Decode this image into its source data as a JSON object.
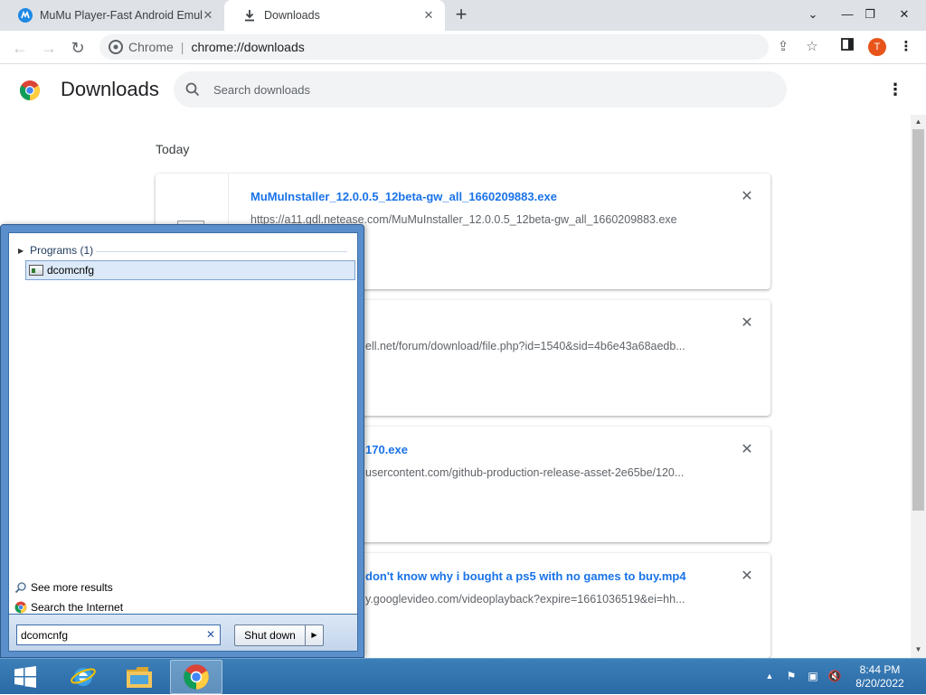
{
  "browser": {
    "tabs": [
      {
        "title": "MuMu Player-Fast Android Emul",
        "active": false
      },
      {
        "title": "Downloads",
        "active": true
      }
    ],
    "new_tab": "+",
    "omnibox": {
      "site": "Chrome",
      "separator": "|",
      "url": "chrome://downloads"
    },
    "avatar_letter": "T"
  },
  "downloads": {
    "title": "Downloads",
    "search_placeholder": "Search downloads",
    "date_header": "Today",
    "items": [
      {
        "name": "MuMuInstaller_12.0.0.5_12beta-gw_all_1660209883.exe",
        "source": "https://a11.gdl.netease.com/MuMuInstaller_12.0.0.5_12beta-gw_all_1660209883.exe"
      },
      {
        "name": "",
        "source": "ell.net/forum/download/file.php?id=1540&sid=4b6e43a68aedb..."
      },
      {
        "name": "170.exe",
        "source": "usercontent.com/github-production-release-asset-2e65be/120..."
      },
      {
        "name": "don't know why i bought a ps5 with no games to buy.mp4",
        "source": "y.googlevideo.com/videoplayback?expire=1661036519&ei=hh..."
      }
    ]
  },
  "start_menu": {
    "group_label": "Programs (1)",
    "result": "dcomcnfg",
    "see_more": "See more results",
    "search_internet": "Search the Internet",
    "search_value": "dcomcnfg",
    "shutdown_label": "Shut down"
  },
  "taskbar": {
    "time": "8:44 PM",
    "date": "8/20/2022"
  },
  "colors": {
    "accent_link": "#1a73e8",
    "avatar": "#e8541a",
    "taskbar": "#2a6aa6"
  }
}
